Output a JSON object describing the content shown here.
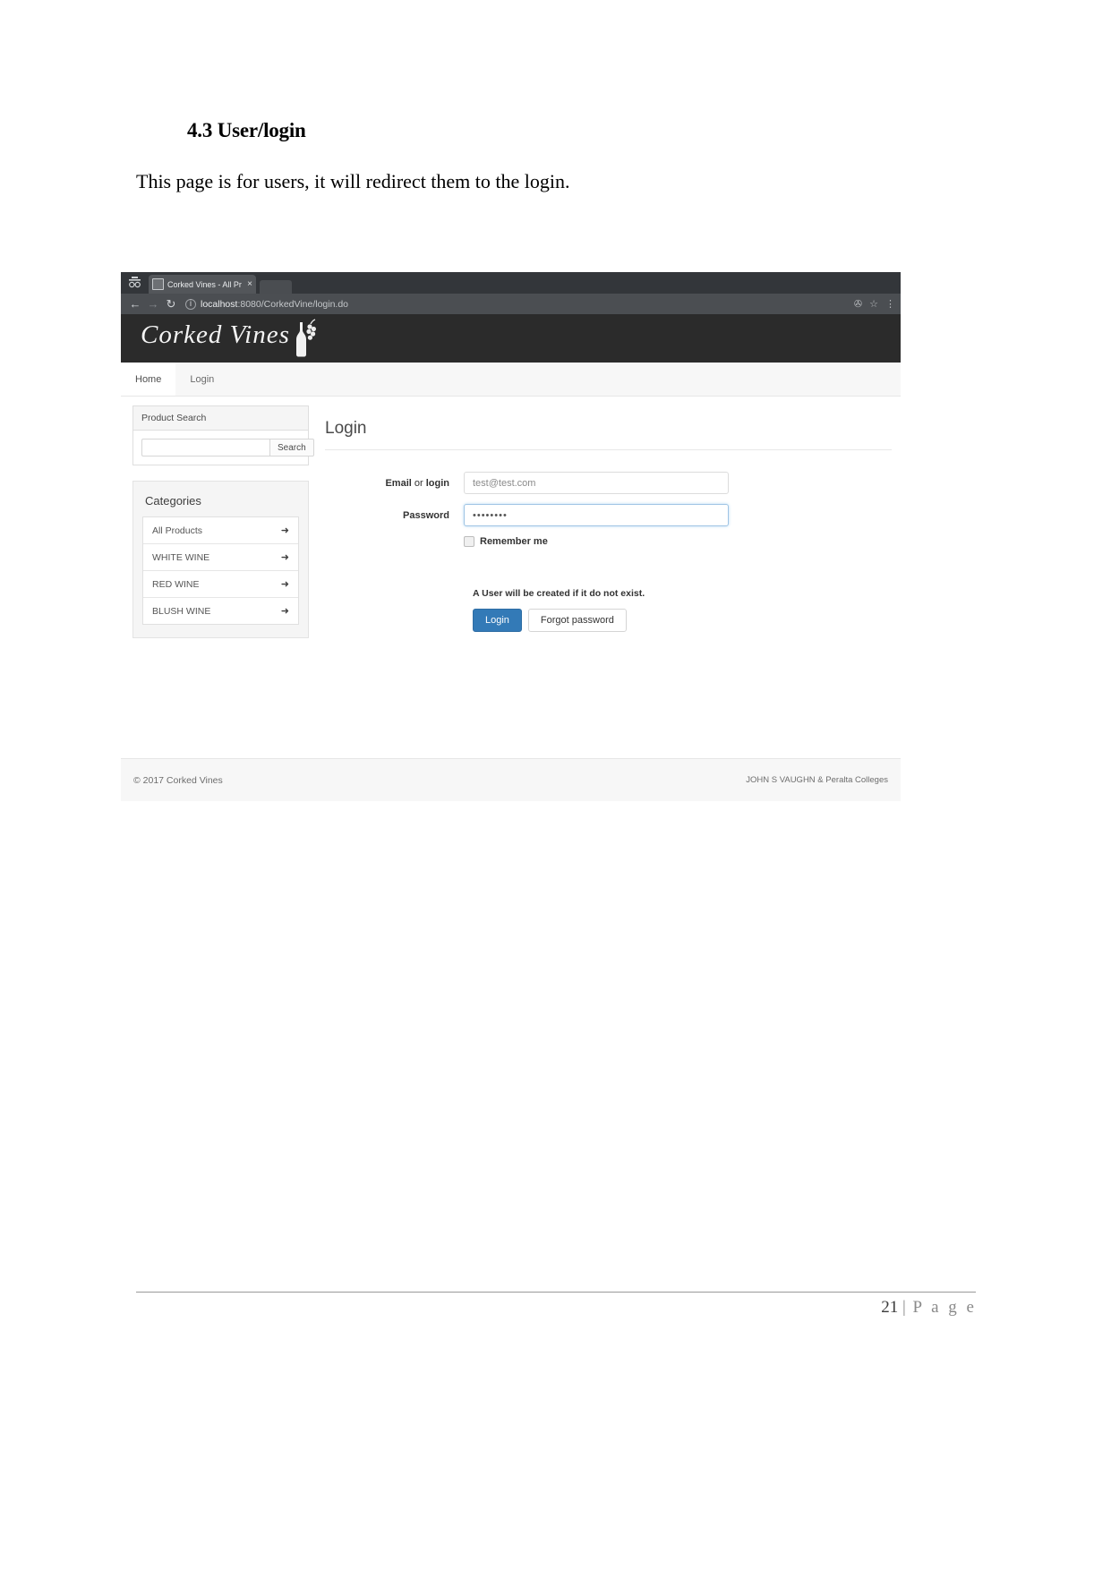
{
  "document": {
    "heading": "4.3 User/login",
    "paragraph": "This page is for users, it will redirect them to the login.",
    "page_number": "21",
    "page_label": "P a g e",
    "page_separator": "|"
  },
  "browser": {
    "system_icon": "incognito-icon",
    "tab": {
      "title": "Corked Vines - All Pr",
      "close_label": "×"
    },
    "toolbar": {
      "back": "←",
      "forward": "→",
      "reload": "↻",
      "site_info": "ⓘ",
      "url_host": "localhost",
      "url_path": ":8080/CorkedVine/login.do",
      "bookmark": "☆",
      "filter": "✇",
      "menu": "⋮"
    }
  },
  "site": {
    "brand": "Corked Vines",
    "nav": [
      {
        "label": "Home",
        "active": true
      },
      {
        "label": "Login",
        "active": false
      }
    ],
    "sidebar": {
      "search_panel_title": "Product Search",
      "search_value": "",
      "search_placeholder": "",
      "search_button": "Search",
      "categories_title": "Categories",
      "categories": [
        {
          "label": "All Products",
          "arrow": "➜"
        },
        {
          "label": "WHITE WINE",
          "arrow": "➜"
        },
        {
          "label": "RED WINE",
          "arrow": "➜"
        },
        {
          "label": "BLUSH WINE",
          "arrow": "➜"
        }
      ]
    },
    "login": {
      "title": "Login",
      "email_label_bold_a": "Email",
      "email_label_light": " or ",
      "email_label_bold_b": "login",
      "email_value": "test@test.com",
      "email_placeholder": "test@test.com",
      "password_label": "Password",
      "password_value": "••••••••",
      "remember_label": "Remember me",
      "remember_checked": false,
      "note": "A User will be created if it do not exist.",
      "login_button": "Login",
      "forgot_button": "Forgot password"
    },
    "footer": {
      "copyright": "© 2017 Corked Vines",
      "credits": "JOHN S VAUGHN & Peralta Colleges"
    },
    "colors": {
      "header_bg": "#2b2b2b",
      "primary_button": "#337ab7",
      "nav_bg": "#f7f7f7"
    }
  }
}
